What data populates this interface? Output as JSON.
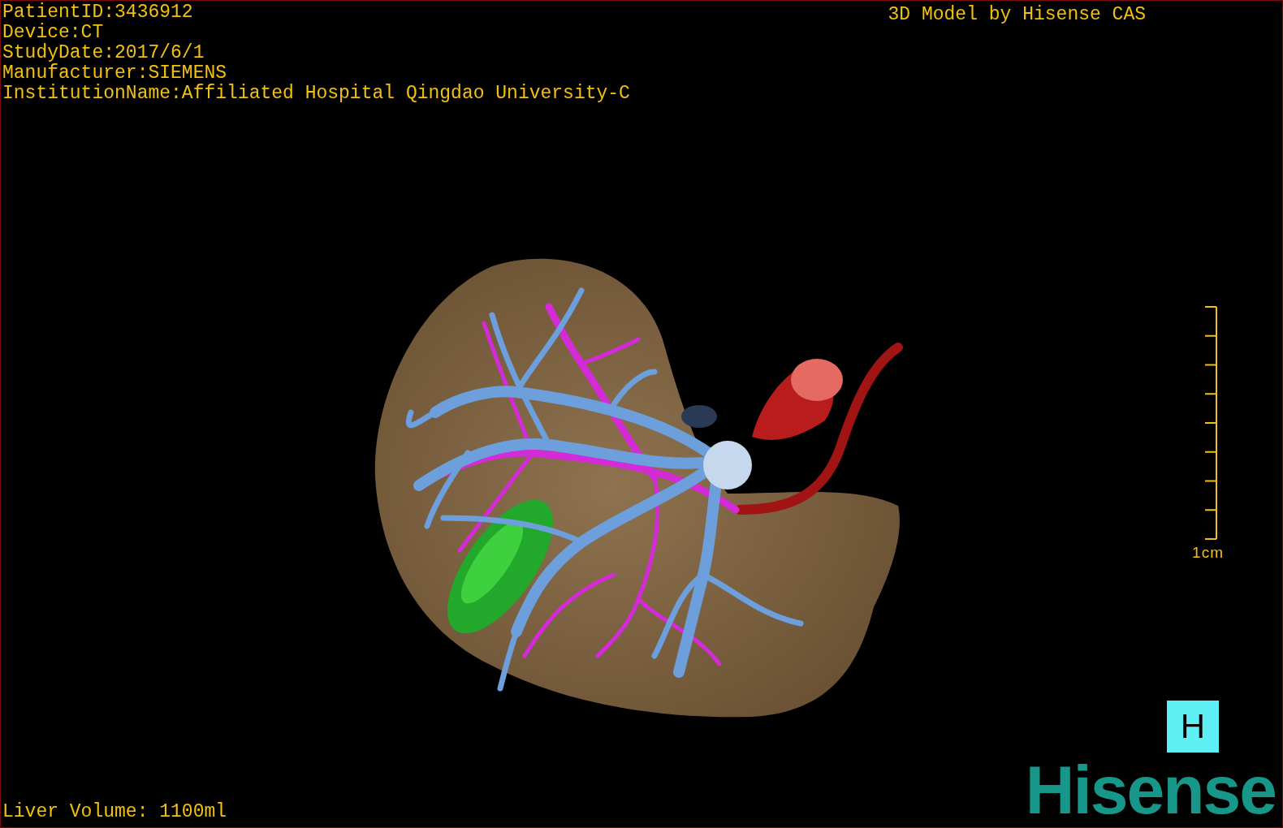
{
  "overlay_info": [
    "PatientID:3436912",
    "Device:CT",
    "StudyDate:2017/6/1",
    "Manufacturer:SIEMENS",
    "InstitutionName:Affiliated Hospital Qingdao University-C"
  ],
  "title": "3D Model by Hisense CAS",
  "scale_bar": {
    "label": "1cm"
  },
  "view_button": {
    "label": "H"
  },
  "liver_volume": "Liver Volume: 1100ml",
  "logo": "Hisense"
}
